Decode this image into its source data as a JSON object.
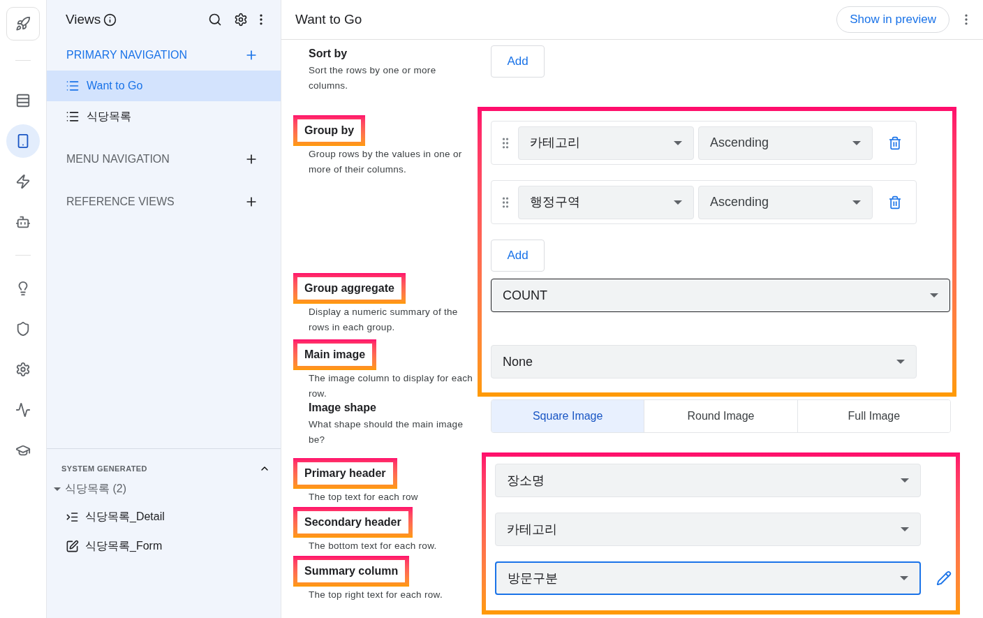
{
  "rail": {
    "items": [
      {
        "kind": "table",
        "selected": false
      },
      {
        "kind": "phone",
        "selected": true
      },
      {
        "kind": "bolt",
        "selected": false
      },
      {
        "kind": "robot",
        "selected": false
      },
      {
        "kind": "divider"
      },
      {
        "kind": "bulb",
        "selected": false
      },
      {
        "kind": "shield",
        "selected": false
      },
      {
        "kind": "gear",
        "selected": false
      },
      {
        "kind": "monitor",
        "selected": false
      },
      {
        "kind": "school",
        "selected": false
      }
    ]
  },
  "sidebar": {
    "title": "Views",
    "sections": [
      {
        "title": "PRIMARY NAVIGATION",
        "active": true,
        "items": [
          {
            "label": "Want to Go",
            "selected": true
          },
          {
            "label": "식당목록",
            "selected": false
          }
        ]
      },
      {
        "title": "MENU NAVIGATION",
        "active": false
      },
      {
        "title": "REFERENCE VIEWS",
        "active": false
      }
    ],
    "system": {
      "title": "SYSTEM GENERATED",
      "expanded": true,
      "tree": [
        {
          "label": "식당목록 (2)",
          "expanded": true,
          "children": [
            {
              "label": "식당목록_Detail",
              "kind": "detail"
            },
            {
              "label": "식당목록_Form",
              "kind": "form"
            }
          ]
        }
      ]
    }
  },
  "main": {
    "title": "Want to Go",
    "preview_button": "Show in preview",
    "groups": [
      {
        "highlighted": false,
        "sections": [
          {
            "kind": "add",
            "label": "Sort by",
            "highlighted": false,
            "description": "Sort the rows by one or more columns.",
            "button": "Add"
          }
        ]
      },
      {
        "highlighted": true,
        "sections": [
          {
            "kind": "sort_list",
            "label": "Group by",
            "highlighted": true,
            "description": "Group rows by the values in one or more of their columns.",
            "rows": [
              {
                "column": "카테고리",
                "order": "Ascending"
              },
              {
                "column": "행정구역",
                "order": "Ascending"
              }
            ],
            "button": "Add"
          },
          {
            "kind": "select",
            "label": "Group aggregate",
            "highlighted": true,
            "description": "Display a numeric summary of the rows in each group.",
            "value": "COUNT",
            "hovered": true,
            "focused": false,
            "editable": false
          },
          {
            "kind": "select",
            "label": "Main image",
            "highlighted": true,
            "description": "The image column to display for each row.",
            "value": "None",
            "hovered": false,
            "focused": false,
            "editable": false
          }
        ]
      },
      {
        "highlighted": false,
        "sections": [
          {
            "kind": "segmented",
            "label": "Image shape",
            "highlighted": false,
            "description": "What shape should the main image be?",
            "options": [
              {
                "label": "Square Image",
                "selected": true
              },
              {
                "label": "Round Image",
                "selected": false
              },
              {
                "label": "Full Image",
                "selected": false
              }
            ]
          }
        ]
      },
      {
        "highlighted": true,
        "sections": [
          {
            "kind": "select",
            "label": "Primary header",
            "highlighted": true,
            "description": "The top text for each row",
            "value": "장소명",
            "hovered": false,
            "focused": false,
            "editable": false
          },
          {
            "kind": "select",
            "label": "Secondary header",
            "highlighted": true,
            "description": "The bottom text for each row.",
            "value": "카테고리",
            "hovered": false,
            "focused": false,
            "editable": false
          },
          {
            "kind": "select",
            "label": "Summary column",
            "highlighted": true,
            "description": "The top right text for each row.",
            "value": "방문구분",
            "hovered": false,
            "focused": true,
            "editable": true
          }
        ]
      }
    ]
  }
}
